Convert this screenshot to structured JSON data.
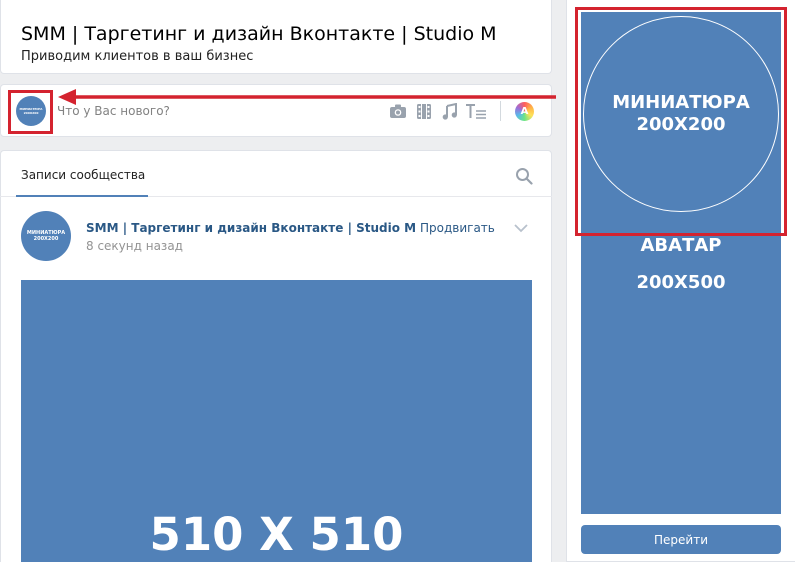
{
  "group": {
    "title": "SMM | Таргетинг и дизайн Вконтакте | Studio M",
    "subtitle": "Приводим клиентов в ваш бизнес"
  },
  "composer": {
    "placeholder": "Что у Вас нового?",
    "avatar_text_line1": "МИНИАТЮРА",
    "avatar_text_line2": "200X200",
    "icons": [
      "camera-icon",
      "video-icon",
      "music-icon",
      "text-format-icon",
      "color-picker-icon"
    ],
    "color_picker_letter": "A"
  },
  "wall": {
    "tab_label": "Записи сообщества",
    "post": {
      "avatar_text_line1": "МИНИАТЮРА",
      "avatar_text_line2": "200X200",
      "author": "SMM | Таргетинг и дизайн Вконтакте | Studio M",
      "time": "8 секунд назад",
      "promote_label": "Продвигать",
      "image_label": "510 X 510"
    }
  },
  "cover": {
    "miniature_line1": "МИНИАТЮРА",
    "miniature_line2": "200X200",
    "avatar_line1": "АВАТАР",
    "avatar_line2": "200X500",
    "button_label": "Перейти"
  },
  "colors": {
    "accent_blue": "#5181b8",
    "link_blue": "#2a5885",
    "highlight_red": "#d4232f",
    "background": "#edeef0"
  }
}
